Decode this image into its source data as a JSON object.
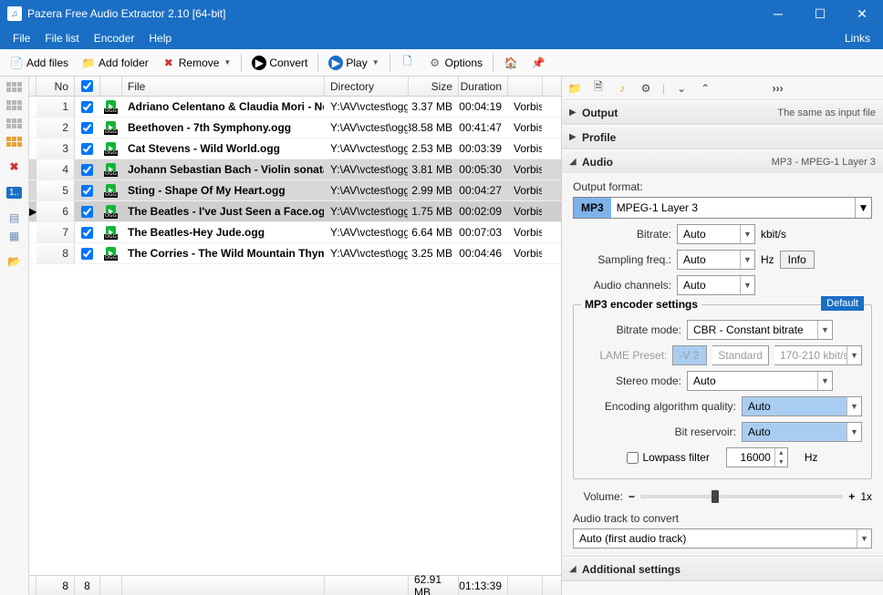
{
  "window": {
    "title": "Pazera Free Audio Extractor 2.10  [64-bit]"
  },
  "menubar": {
    "items": [
      "File",
      "File list",
      "Encoder",
      "Help"
    ],
    "right": "Links"
  },
  "toolbar": {
    "add_files": "Add files",
    "add_folder": "Add folder",
    "remove": "Remove",
    "convert": "Convert",
    "play": "Play",
    "options": "Options"
  },
  "columns": {
    "no": "No",
    "file": "File",
    "dir": "Directory",
    "size": "Size",
    "dur": "Duration",
    "fmt": ""
  },
  "rows": [
    {
      "no": 1,
      "file": "Adriano Celentano & Claudia Mori - No...",
      "dir": "Y:\\AV\\vctest\\ogg",
      "size": "3.37 MB",
      "dur": "00:04:19",
      "fmt": "Vorbis",
      "sel": false,
      "cur": false
    },
    {
      "no": 2,
      "file": "Beethoven - 7th Symphony.ogg",
      "dir": "Y:\\AV\\vctest\\ogg",
      "size": "38.58 MB",
      "dur": "00:41:47",
      "fmt": "Vorbis",
      "sel": false,
      "cur": false
    },
    {
      "no": 3,
      "file": "Cat Stevens - Wild World.ogg",
      "dir": "Y:\\AV\\vctest\\ogg",
      "size": "2.53 MB",
      "dur": "00:03:39",
      "fmt": "Vorbis",
      "sel": false,
      "cur": false
    },
    {
      "no": 4,
      "file": "Johann Sebastian Bach - Violin sonata ...",
      "dir": "Y:\\AV\\vctest\\ogg",
      "size": "3.81 MB",
      "dur": "00:05:30",
      "fmt": "Vorbis",
      "sel": true,
      "cur": false
    },
    {
      "no": 5,
      "file": "Sting - Shape Of My Heart.ogg",
      "dir": "Y:\\AV\\vctest\\ogg",
      "size": "2.99 MB",
      "dur": "00:04:27",
      "fmt": "Vorbis",
      "sel": true,
      "cur": false
    },
    {
      "no": 6,
      "file": "The Beatles - I've Just Seen a Face.ogg",
      "dir": "Y:\\AV\\vctest\\ogg",
      "size": "1.75 MB",
      "dur": "00:02:09",
      "fmt": "Vorbis",
      "sel": true,
      "cur": true
    },
    {
      "no": 7,
      "file": "The Beatles-Hey Jude.ogg",
      "dir": "Y:\\AV\\vctest\\ogg",
      "size": "6.64 MB",
      "dur": "00:07:03",
      "fmt": "Vorbis",
      "sel": false,
      "cur": false
    },
    {
      "no": 8,
      "file": "The Corries - The Wild Mountain Thyme...",
      "dir": "Y:\\AV\\vctest\\ogg",
      "size": "3.25 MB",
      "dur": "00:04:46",
      "fmt": "Vorbis",
      "sel": false,
      "cur": false
    }
  ],
  "status": {
    "count1": "8",
    "count2": "8",
    "total_size": "62.91 MB",
    "total_dur": "01:13:39"
  },
  "rp": {
    "output": {
      "title": "Output",
      "info": "The same as input file"
    },
    "profile": {
      "title": "Profile"
    },
    "audio": {
      "title": "Audio",
      "info": "MP3 - MPEG-1 Layer 3",
      "out_format_label": "Output format:",
      "out_format_tag": "MP3",
      "out_format_text": "MPEG-1 Layer 3",
      "bitrate_label": "Bitrate:",
      "bitrate_val": "Auto",
      "bitrate_unit": "kbit/s",
      "samp_label": "Sampling freq.:",
      "samp_val": "Auto",
      "samp_unit": "Hz",
      "info_btn": "Info",
      "chan_label": "Audio channels:",
      "chan_val": "Auto",
      "mp3_fieldset": "MP3 encoder settings",
      "default_btn": "Default",
      "brmode_label": "Bitrate mode:",
      "brmode_val": "CBR - Constant bitrate",
      "lame_label": "LAME Preset:",
      "lame_v": "-V 2",
      "lame_std": "Standard",
      "lame_range": "170-210 kbit/s",
      "stereo_label": "Stereo mode:",
      "stereo_val": "Auto",
      "encq_label": "Encoding algorithm quality:",
      "encq_val": "Auto",
      "bitres_label": "Bit reservoir:",
      "bitres_val": "Auto",
      "lowpass_label": "Lowpass filter",
      "lowpass_val": "16000",
      "lowpass_unit": "Hz",
      "volume_label": "Volume:",
      "volume_text": "1x",
      "track_label": "Audio track to convert",
      "track_val": "Auto (first audio track)"
    },
    "additional": {
      "title": "Additional settings"
    }
  }
}
